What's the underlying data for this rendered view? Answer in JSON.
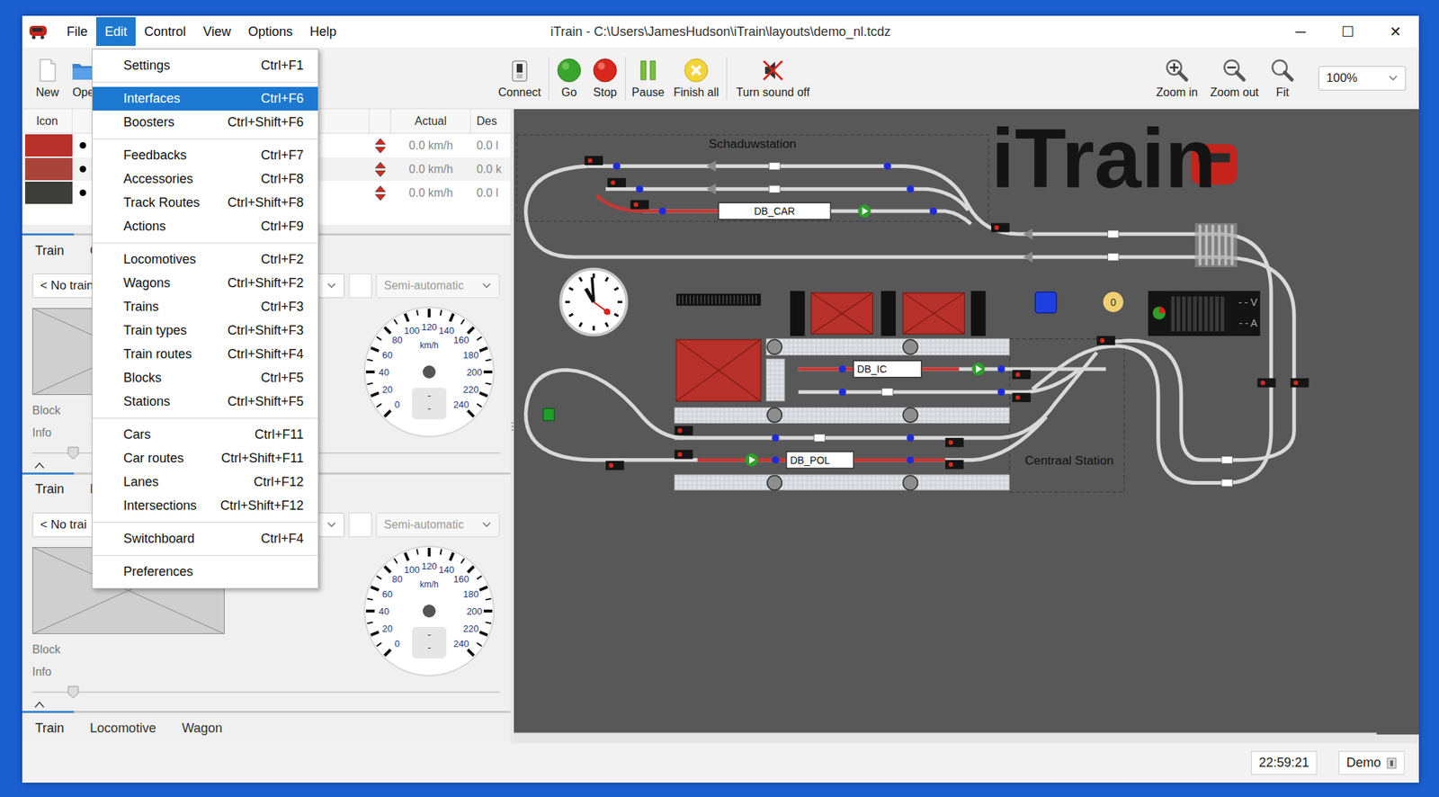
{
  "window": {
    "title": "iTrain - C:\\Users\\JamesHudson\\iTrain\\layouts\\demo_nl.tcdz",
    "controls": [
      "─",
      "☐",
      "✕"
    ]
  },
  "menubar": [
    {
      "label": "File",
      "selected": false
    },
    {
      "label": "Edit",
      "selected": true
    },
    {
      "label": "Control",
      "selected": false
    },
    {
      "label": "View",
      "selected": false
    },
    {
      "label": "Options",
      "selected": false
    },
    {
      "label": "Help",
      "selected": false
    }
  ],
  "toolbar": {
    "items": [
      {
        "label": "New",
        "kind": "new"
      },
      {
        "label": "Ope",
        "kind": "open"
      },
      {
        "label": "Connect",
        "kind": "connect"
      },
      {
        "label": "Go",
        "kind": "go"
      },
      {
        "label": "Stop",
        "kind": "stop"
      },
      {
        "label": "Pause",
        "kind": "pause"
      },
      {
        "label": "Finish all",
        "kind": "finish"
      },
      {
        "label": "Turn sound off",
        "kind": "sound"
      }
    ],
    "zoom": [
      {
        "label": "Zoom in",
        "kind": "zoom-in"
      },
      {
        "label": "Zoom out",
        "kind": "zoom-out"
      },
      {
        "label": "Fit",
        "kind": "fit"
      }
    ],
    "zoom_level": "100%"
  },
  "edit_menu": {
    "groups": [
      [
        {
          "label": "Settings",
          "shortcut": "Ctrl+F1",
          "selected": false
        }
      ],
      [
        {
          "label": "Interfaces",
          "shortcut": "Ctrl+F6",
          "selected": true
        },
        {
          "label": "Boosters",
          "shortcut": "Ctrl+Shift+F6",
          "selected": false
        }
      ],
      [
        {
          "label": "Feedbacks",
          "shortcut": "Ctrl+F7",
          "selected": false
        },
        {
          "label": "Accessories",
          "shortcut": "Ctrl+F8",
          "selected": false
        },
        {
          "label": "Track Routes",
          "shortcut": "Ctrl+Shift+F8",
          "selected": false
        },
        {
          "label": "Actions",
          "shortcut": "Ctrl+F9",
          "selected": false
        }
      ],
      [
        {
          "label": "Locomotives",
          "shortcut": "Ctrl+F2",
          "selected": false
        },
        {
          "label": "Wagons",
          "shortcut": "Ctrl+Shift+F2",
          "selected": false
        },
        {
          "label": "Trains",
          "shortcut": "Ctrl+F3",
          "selected": false
        },
        {
          "label": "Train types",
          "shortcut": "Ctrl+Shift+F3",
          "selected": false
        },
        {
          "label": "Train routes",
          "shortcut": "Ctrl+Shift+F4",
          "selected": false
        },
        {
          "label": "Blocks",
          "shortcut": "Ctrl+F5",
          "selected": false
        },
        {
          "label": "Stations",
          "shortcut": "Ctrl+Shift+F5",
          "selected": false
        }
      ],
      [
        {
          "label": "Cars",
          "shortcut": "Ctrl+F11",
          "selected": false
        },
        {
          "label": "Car routes",
          "shortcut": "Ctrl+Shift+F11",
          "selected": false
        },
        {
          "label": "Lanes",
          "shortcut": "Ctrl+F12",
          "selected": false
        },
        {
          "label": "Intersections",
          "shortcut": "Ctrl+Shift+F12",
          "selected": false
        }
      ],
      [
        {
          "label": "Switchboard",
          "shortcut": "Ctrl+F4",
          "selected": false
        }
      ],
      [
        {
          "label": "Preferences",
          "shortcut": "",
          "selected": false
        }
      ]
    ]
  },
  "locomotives": {
    "columns": [
      "Icon",
      "Actual",
      "Des"
    ],
    "rows": [
      {
        "color": "#b8312b",
        "actual": "0.0 km/h",
        "desired": "0.0 l"
      },
      {
        "color": "#a8443c",
        "actual": "0.0 km/h",
        "desired": "0.0 k"
      },
      {
        "color": "#3d3d3a",
        "actual": "0.0 km/h",
        "desired": "0.0 l"
      }
    ]
  },
  "train_panels": [
    {
      "tabs": [
        {
          "label": "Train",
          "selected": true
        },
        {
          "label": "C",
          "selected": false
        }
      ],
      "train": "< No train",
      "mode": "Semi-automatic",
      "block_label": "Block",
      "info_label": "Info",
      "speed_level": 0,
      "readout": [
        "-",
        "-"
      ]
    },
    {
      "tabs": [
        {
          "label": "Train",
          "selected": true
        },
        {
          "label": "L",
          "selected": false
        }
      ],
      "train": "< No trai",
      "mode": "Semi-automatic",
      "block_label": "Block",
      "info_label": "Info",
      "speed_level": 0,
      "readout": [
        "-",
        "-"
      ]
    }
  ],
  "speedometer": {
    "unit": "km/h",
    "ticks": [
      "0",
      "20",
      "40",
      "60",
      "80",
      "100",
      "120",
      "140",
      "160",
      "180",
      "200",
      "220",
      "240"
    ]
  },
  "bottom_tabs": [
    {
      "label": "Train",
      "selected": true
    },
    {
      "label": "Locomotive",
      "selected": false
    },
    {
      "label": "Wagon",
      "selected": false
    }
  ],
  "canvas": {
    "logo": "iTrain",
    "stations": [
      "Schaduwstation",
      "Centraal Station"
    ],
    "blocks": [
      "DB_CAR",
      "DB_IC",
      "DB_POL"
    ],
    "counter": "0",
    "meter": [
      "- - V",
      "- - A"
    ]
  },
  "status_bar": {
    "time": "22:59:21",
    "mode": "Demo"
  }
}
